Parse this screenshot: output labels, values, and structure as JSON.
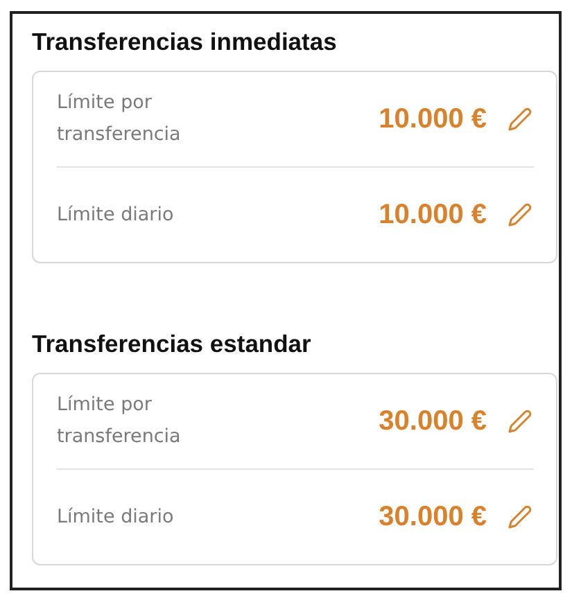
{
  "sections": [
    {
      "title": "Transferencias inmediatas",
      "rows": [
        {
          "label": "Límite por transferencia",
          "amount": "10.000 €"
        },
        {
          "label": "Límite diario",
          "amount": "10.000 €"
        }
      ]
    },
    {
      "title": "Transferencias estandar",
      "rows": [
        {
          "label": "Límite por transferencia",
          "amount": "30.000 €"
        },
        {
          "label": "Límite diario",
          "amount": "30.000 €"
        }
      ]
    }
  ]
}
